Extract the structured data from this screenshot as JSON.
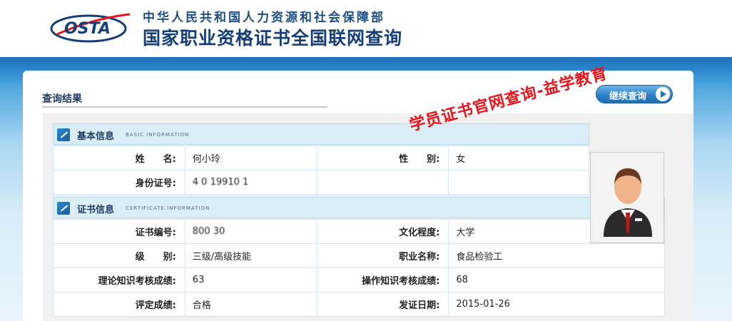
{
  "header": {
    "logo_text": "OSTA",
    "ministry": "中华人民共和国人力资源和社会保障部",
    "site_title": "国家职业资格证书全国联网查询"
  },
  "panel": {
    "result_title": "查询结果",
    "continue_button": "继续查询",
    "stamp_text": "学员证书官网查询-益学教育"
  },
  "basic_info": {
    "title_cn": "基本信息",
    "title_en": "BASIC INFORMATION",
    "name_label": "姓　　名:",
    "name_value": "何小玲",
    "gender_label": "性　　别:",
    "gender_value": "女",
    "id_label": "身份证号:",
    "id_value": "4 0 19910 1"
  },
  "certificate_info": {
    "title_cn": "证书信息",
    "title_en": "CERTIFICATE INFORMATION",
    "rows": [
      {
        "label1": "证书编号:",
        "value1": "800 30",
        "label2": "文化程度:",
        "value2": "大学"
      },
      {
        "label1": "级　　别:",
        "value1": "三级/高级技能",
        "label2": "职业名称:",
        "value2": "食品检验工"
      },
      {
        "label1": "理论知识考核成绩:",
        "value1": "63",
        "label2": "操作知识考核成绩:",
        "value2": "68"
      },
      {
        "label1": "评定成绩:",
        "value1": "合格",
        "label2": "发证日期:",
        "value2": "2015-01-26"
      }
    ]
  },
  "icons": {
    "logo": "osta-logo",
    "section": "pen-icon",
    "button": "arrow-right-icon",
    "photo": "person-avatar"
  },
  "colors": {
    "brand_blue": "#1c4e86",
    "stamp_red": "#e8141b",
    "section_bg": "#d9eef6"
  }
}
